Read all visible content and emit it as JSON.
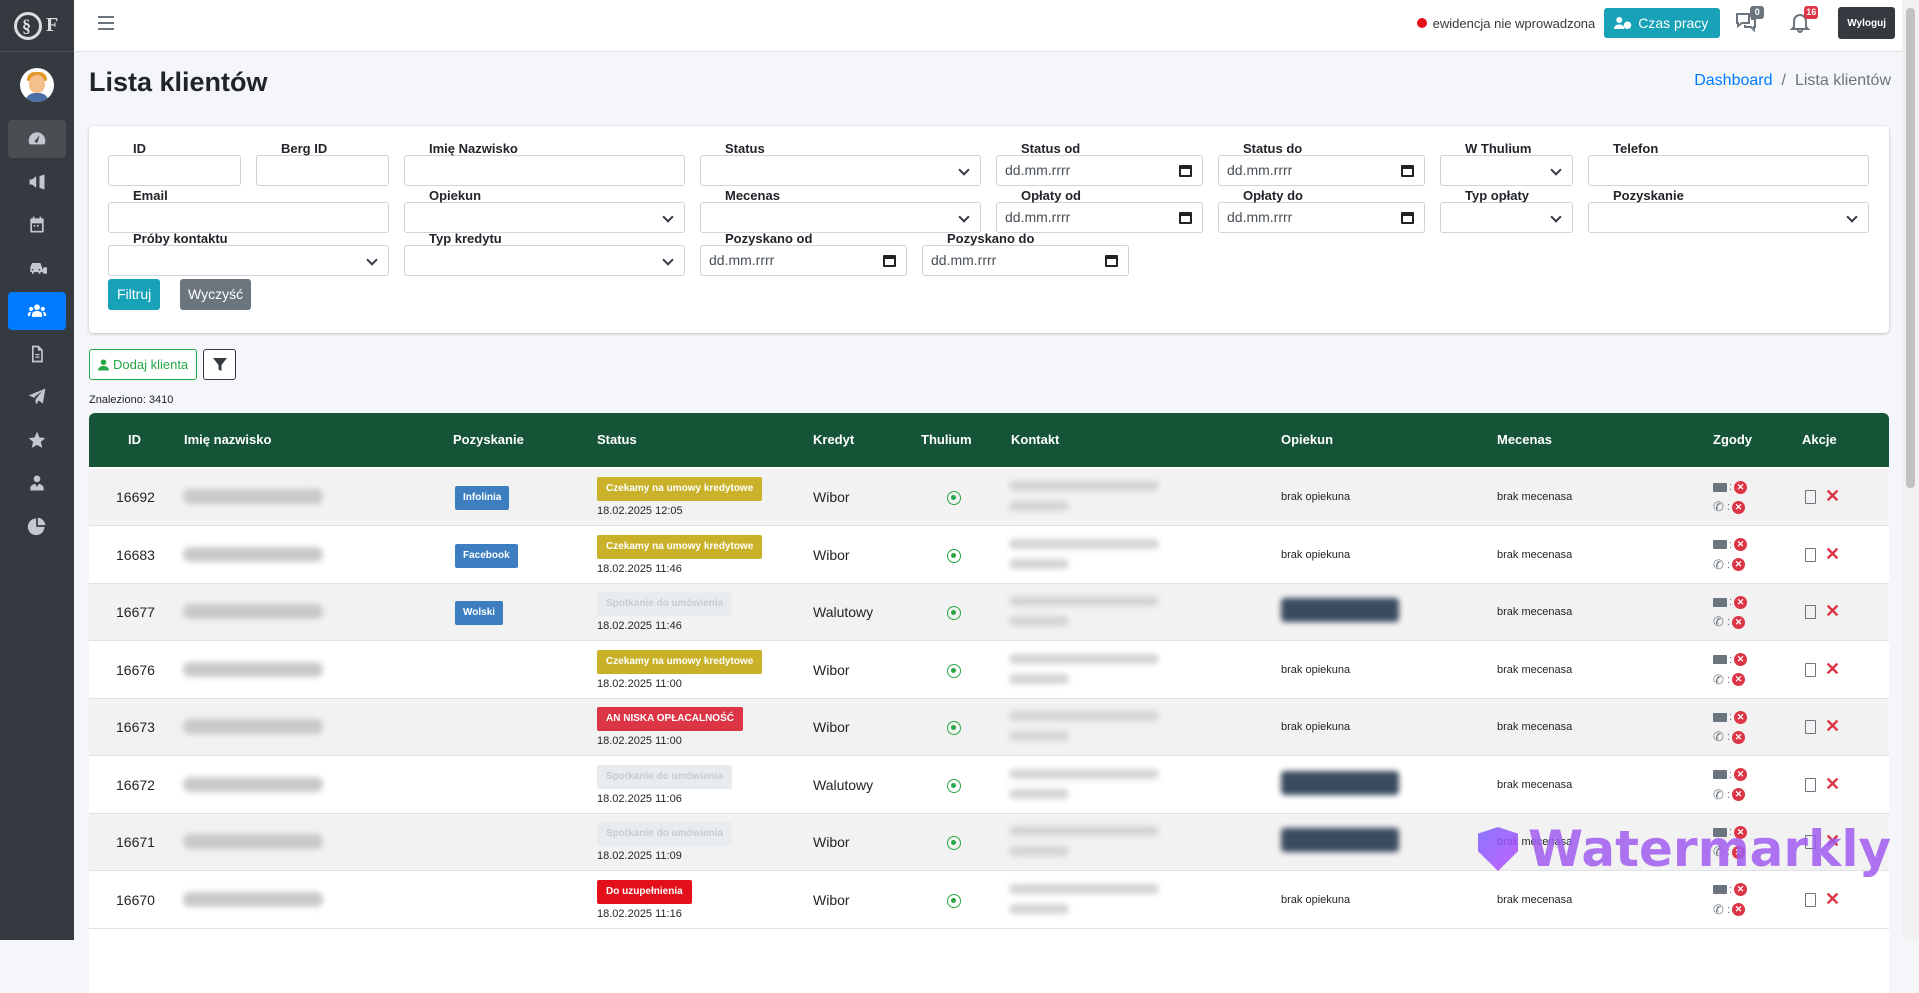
{
  "topbar": {
    "status_text": "ewidencja nie wprowadzona",
    "time_button": "Czas pracy",
    "messages_count": "0",
    "notifications_count": "16",
    "logout": "Wyloguj"
  },
  "sidebar": {
    "items": [
      "dashboard-icon",
      "campaign-icon",
      "calendar-icon",
      "car-icon",
      "users-icon",
      "file-icon",
      "send-icon",
      "star-icon",
      "user-tie-icon",
      "pie-chart-icon"
    ]
  },
  "page": {
    "title": "Lista klientów",
    "breadcrumb_home": "Dashboard",
    "breadcrumb_sep": "/",
    "breadcrumb_current": "Lista klientów"
  },
  "filters": {
    "id": "ID",
    "berg_id": "Berg ID",
    "name": "Imię Nazwisko",
    "status": "Status",
    "status_from": "Status od",
    "status_to": "Status do",
    "thulium": "W Thulium",
    "phone": "Telefon",
    "email": "Email",
    "guardian": "Opiekun",
    "patron": "Mecenas",
    "paid_from": "Opłaty od",
    "paid_to": "Opłaty do",
    "fee_type": "Typ opłaty",
    "acquisition": "Pozyskanie",
    "contact_attempts": "Próby kontaktu",
    "credit_type": "Typ kredytu",
    "acquired_from": "Pozyskano od",
    "acquired_to": "Pozyskano do",
    "date_placeholder": "dd.mm.rrrr",
    "filter_button": "Filtruj",
    "clear_button": "Wyczyść"
  },
  "actions": {
    "add_client": "Dodaj klienta",
    "found": "Znaleziono: 3410"
  },
  "table": {
    "headers": {
      "id": "ID",
      "name": "Imię nazwisko",
      "source": "Pozyskanie",
      "status": "Status",
      "credit": "Kredyt",
      "thulium": "Thulium",
      "contact": "Kontakt",
      "guardian": "Opiekun",
      "patron": "Mecenas",
      "consents": "Zgody",
      "actions": "Akcje"
    },
    "rows": [
      {
        "id": "16692",
        "source": "Infolinia",
        "status": "Czekamy na umowy kredytowe",
        "date": "18.02.2025 12:05",
        "credit": "Wibor",
        "guardian": "brak opiekuna",
        "patron": "brak mecenasa"
      },
      {
        "id": "16683",
        "source": "Facebook",
        "status": "Czekamy na umowy kredytowe",
        "date": "18.02.2025 11:46",
        "credit": "Wibor",
        "guardian": "brak opiekuna",
        "patron": "brak mecenasa"
      },
      {
        "id": "16677",
        "source": "Wolski",
        "status": "Spotkanie do umówienia",
        "date": "18.02.2025 11:46",
        "credit": "Walutowy",
        "guardian": "",
        "patron": "brak mecenasa"
      },
      {
        "id": "16676",
        "source": "",
        "status": "Czekamy na umowy kredytowe",
        "date": "18.02.2025 11:00",
        "credit": "Wibor",
        "guardian": "brak opiekuna",
        "patron": "brak mecenasa"
      },
      {
        "id": "16673",
        "source": "",
        "status": "AN NISKA OPŁACALNOŚĆ",
        "date": "18.02.2025 11:00",
        "credit": "Wibor",
        "guardian": "brak opiekuna",
        "patron": "brak mecenasa"
      },
      {
        "id": "16672",
        "source": "",
        "status": "Spotkanie do umówienia",
        "date": "18.02.2025 11:06",
        "credit": "Walutowy",
        "guardian": "",
        "patron": "brak mecenasa"
      },
      {
        "id": "16671",
        "source": "",
        "status": "Spotkanie do umówienia",
        "date": "18.02.2025 11:09",
        "credit": "Wibor",
        "guardian": "",
        "patron": "brak mecenasa"
      },
      {
        "id": "16670",
        "source": "",
        "status": "Do uzupełnienia",
        "date": "18.02.2025 11:16",
        "credit": "Wibor",
        "guardian": "brak opiekuna",
        "patron": "brak mecenasa"
      }
    ]
  },
  "watermark": "Watermarkly"
}
